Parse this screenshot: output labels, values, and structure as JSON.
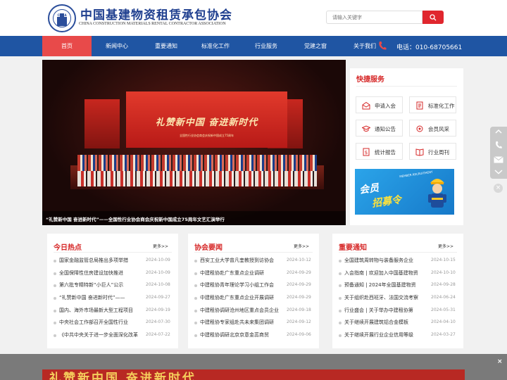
{
  "header": {
    "logo_text": "CMRA",
    "title": "中国基建物资租赁承包协会",
    "subtitle": "CHINA CONSTRUCTION MATERIALS RENTAL CONTRACTOR ASSOCIATION",
    "search_placeholder": "请输入关键字"
  },
  "nav": {
    "items": [
      "首页",
      "新闻中心",
      "重要通知",
      "标准化工作",
      "行业服务",
      "党建之窗",
      "关于我们"
    ],
    "active": "首页",
    "phone": "电话：010-68705661"
  },
  "banner": {
    "screen_title": "礼赞新中国  奋进新时代",
    "screen_sub": "全国性行业协会商会庆祝新中国成立75周年",
    "screen_sub2": "文艺汇演",
    "caption": "“礼赞新中国 奋进新时代”——全国性行业协会商会庆祝新中国成立75周年文艺汇演举行"
  },
  "quick": {
    "title": "快捷服务",
    "buttons": [
      "申请入会",
      "标准化工作",
      "通知公告",
      "会员风采",
      "统计报告",
      "行业周刊"
    ],
    "recruit_1": "会员",
    "recruit_2": "招募令",
    "recruit_small": "MEMBER RECRUITMENT"
  },
  "cards": [
    {
      "title": "今日热点",
      "more": "更多>>",
      "items": [
        {
          "t": "国家金融监管总局推出多项举措",
          "d": "2024-10-09"
        },
        {
          "t": "全国保障性住房建设加快推进",
          "d": "2024-10-09"
        },
        {
          "t": "第六批专精特新“小巨人”公示",
          "d": "2024-10-08"
        },
        {
          "t": "“礼赞新中国 奋进新时代”——",
          "d": "2024-09-27"
        },
        {
          "t": "国内、海外市场最新大型工程项目",
          "d": "2024-09-19"
        },
        {
          "t": "中央社会工作部召开全国性行业",
          "d": "2024-07-30"
        },
        {
          "t": "《中共中央关于进一步全面深化改革",
          "d": "2024-07-22"
        }
      ]
    },
    {
      "title": "协会要闻",
      "more": "更多>>",
      "items": [
        {
          "t": "西安工业大学曾凡奎教授到访协会",
          "d": "2024-10-12"
        },
        {
          "t": "中建租协赴广东重点企业调研",
          "d": "2024-09-29"
        },
        {
          "t": "中建租协青年理论学习小组工作会",
          "d": "2024-09-29"
        },
        {
          "t": "中建租协赴广东重点企业开展调研",
          "d": "2024-09-29"
        },
        {
          "t": "中建租协调研沧州地区重点会员企业",
          "d": "2024-09-18"
        },
        {
          "t": "中建租协专家组赴共未来集团调研",
          "d": "2024-09-12"
        },
        {
          "t": "中建租协调研北京京意金蕊商贸",
          "d": "2024-09-06"
        }
      ]
    },
    {
      "title": "重要通知",
      "more": "更多>>",
      "items": [
        {
          "t": "全国建筑周转物与装备服务企业",
          "d": "2024-10-15"
        },
        {
          "t": "入会指南 | 欢迎加入中国基建物资",
          "d": "2024-10-10"
        },
        {
          "t": "预备通知 | 2024年全国基建物资",
          "d": "2024-09-28"
        },
        {
          "t": "关于组织赴西班牙、法国交流考察",
          "d": "2024-06-24"
        },
        {
          "t": "行业盛会 | 关于举办中建租协第",
          "d": "2024-05-31"
        },
        {
          "t": "关于继续开展建筑铝合金模板",
          "d": "2024-04-10"
        },
        {
          "t": "关于继续开展行业企业信用等级",
          "d": "2024-03-27"
        }
      ]
    }
  ],
  "float": {
    "close": "×"
  },
  "bottom": {
    "ad_text": "礼赞新中国  奋进新时代",
    "close": "×"
  },
  "colors": {
    "brand_blue": "#1f55a3",
    "accent_red": "#e84a4a",
    "title_red": "#d62828"
  }
}
